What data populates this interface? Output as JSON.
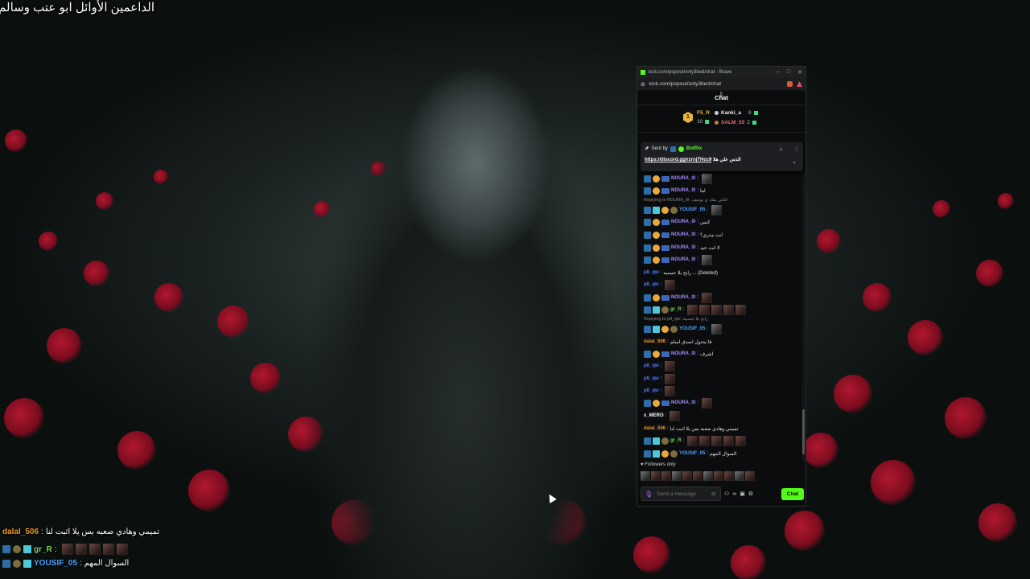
{
  "overlay": {
    "title": "الداعمين الأوائل ابو عتب وسالم",
    "chat": [
      {
        "user": "dalal_506",
        "sep": " : ",
        "text": "تميمي وهادي صعبه بس يلا اثبت لنا",
        "user_color": "#e89b2a"
      },
      {
        "user": "gr_R",
        "sep": " : ",
        "text": "",
        "user_color": "#7dd35a",
        "emotes": 5
      },
      {
        "user": "YOUSIF_05",
        "sep": " : ",
        "text": "السوال المهم",
        "user_color": "#4aa3ff"
      }
    ]
  },
  "window": {
    "tab_title": "kick.com/popout/only3bed/chat - Brave",
    "url": "kick.com/popout/only3bed/chat",
    "controls": [
      "–",
      "□",
      "✕"
    ]
  },
  "chat": {
    "header": "Chat",
    "leaderboard": {
      "rank_badge": "1",
      "first": {
        "name": "F5_R",
        "count": "10"
      },
      "second": {
        "name": "Kanki_a",
        "count": "8"
      },
      "third": {
        "name": "SALM_55",
        "count": "2"
      }
    },
    "pinned": {
      "sent_by": "Sent by",
      "bot_name": "BotRix",
      "text_prefix": "الدس علي هلا",
      "link": "https://discord.gg/rzrnjTHcc9"
    },
    "messages": [
      {
        "user": "NOURA_0l",
        "text": "",
        "color": "#a58cff",
        "badges": [
          "mod",
          "vip",
          "tag"
        ],
        "emote": "gray"
      },
      {
        "user": "NOURA_0l",
        "text": "اما",
        "color": "#a58cff",
        "badges": [
          "mod",
          "vip",
          "tag"
        ]
      },
      {
        "reply": "Replying to NOURA_0l: فكني منك ي يوسف"
      },
      {
        "user": "YOUSIF_05",
        "text": "",
        "color": "#4aa3ff",
        "badges": [
          "mod",
          "sub",
          "vip",
          "og"
        ],
        "emote": "gray"
      },
      {
        "user": "NOURA_0l",
        "text": "كيس",
        "color": "#a58cff",
        "badges": [
          "mod",
          "vip",
          "tag"
        ]
      },
      {
        "user": "NOURA_0l",
        "text": "انت مدري؟",
        "color": "#a58cff",
        "badges": [
          "mod",
          "vip",
          "tag"
        ]
      },
      {
        "user": "NOURA_0l",
        "text": "لا انت عيد",
        "color": "#a58cff",
        "badges": [
          "mod",
          "vip",
          "tag"
        ]
      },
      {
        "user": "NOURA_0l",
        "text": "",
        "color": "#a58cff",
        "badges": [
          "mod",
          "vip",
          "tag"
        ],
        "emote": "gray"
      },
      {
        "user": "p8_qw",
        "text": "رابح يلا جسبيه ... (Deleted)",
        "color": "#4f7cff",
        "badges": []
      },
      {
        "user": "p8_qw",
        "text": "",
        "color": "#4f7cff",
        "badges": [],
        "emote": "red"
      },
      {
        "user": "NOURA_0l",
        "text": "",
        "color": "#a58cff",
        "badges": [
          "mod",
          "vip",
          "tag"
        ],
        "emote": "red"
      },
      {
        "user": "gr_R",
        "text": "",
        "color": "#7dd35a",
        "badges": [
          "mod",
          "sub",
          "og"
        ],
        "emotes": 5
      },
      {
        "reply": "Replying to p8_qw: رابح يلا جسبيه"
      },
      {
        "user": "YOUSIF_05",
        "text": "",
        "color": "#4aa3ff",
        "badges": [
          "mod",
          "sub",
          "vip",
          "og"
        ],
        "emote": "gray"
      },
      {
        "user": "dalal_506",
        "text": "قا يحتول اصدق اسلم",
        "color": "#e89b2a",
        "badges": []
      },
      {
        "user": "NOURA_0l",
        "text": "اشرف",
        "color": "#a58cff",
        "badges": [
          "mod",
          "vip",
          "tag"
        ]
      },
      {
        "user": "p8_qw",
        "text": "",
        "color": "#4f7cff",
        "badges": [],
        "emote": "red"
      },
      {
        "user": "p8_qw",
        "text": "",
        "color": "#4f7cff",
        "badges": [],
        "emote": "red"
      },
      {
        "user": "p8_qw",
        "text": "",
        "color": "#4f7cff",
        "badges": [],
        "emote": "red"
      },
      {
        "user": "NOURA_0l",
        "text": "",
        "color": "#a58cff",
        "badges": [
          "mod",
          "vip",
          "tag"
        ],
        "emote": "red"
      },
      {
        "user": "x_MERO",
        "text": "",
        "color": "#ffffff",
        "badges": [],
        "emote": "red"
      },
      {
        "user": "dalal_506",
        "text": "تميمي وهادي صعبه بس يلا اثبت لنا",
        "color": "#e89b2a",
        "badges": []
      },
      {
        "user": "gr_R",
        "text": "",
        "color": "#7dd35a",
        "badges": [
          "mod",
          "sub",
          "og"
        ],
        "emotes": 5
      },
      {
        "user": "YOUSIF_05",
        "text": "السوال المهم",
        "color": "#4aa3ff",
        "badges": [
          "mod",
          "sub",
          "vip",
          "og"
        ]
      }
    ],
    "followers_only": "Followers only",
    "input_placeholder": "Send a message",
    "send_label": "Chat"
  },
  "colors": {
    "accent": "#53fc18",
    "background": "#0b0c0d"
  }
}
